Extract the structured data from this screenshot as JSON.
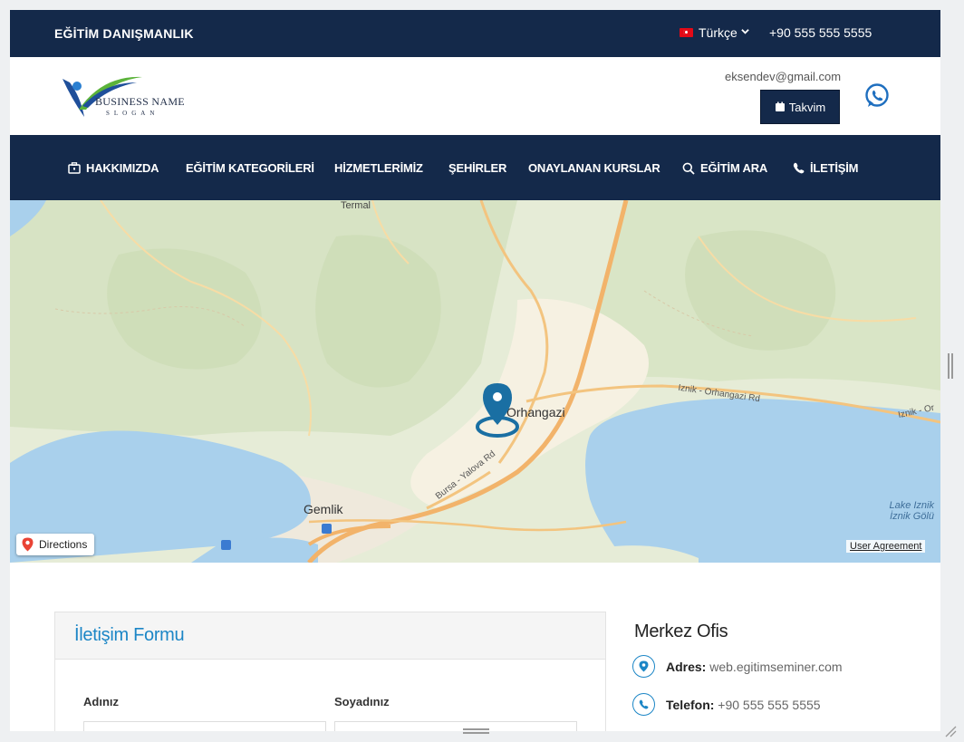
{
  "topbar": {
    "brand": "EĞİTİM DANIŞMANLIK",
    "language": "Türkçe",
    "phone": "+90 555 555 5555"
  },
  "header": {
    "logo_name": "BUSINESS NAME",
    "logo_slogan": "SLOGAN",
    "email": "eksendev@gmail.com",
    "calendar_button": "Takvim"
  },
  "nav": {
    "items": [
      {
        "label": "HAKKIMIZDA",
        "icon": "briefcase-icon"
      },
      {
        "label": "EĞİTİM KATEGORİLERİ"
      },
      {
        "label": "HİZMETLERİMİZ"
      },
      {
        "label": "ŞEHİRLER"
      },
      {
        "label": "ONAYLANAN KURSLAR"
      },
      {
        "label": "EĞİTİM ARA",
        "icon": "search-icon"
      },
      {
        "label": "İLETİŞİM",
        "icon": "phone-icon"
      }
    ]
  },
  "map": {
    "labels": {
      "termal": "Termal",
      "orhangazi": "Orhangazi",
      "gemlik": "Gemlik",
      "road_iznik_1": "Iznik - Orhangazi Rd",
      "road_iznik_2": "Iznik - Or",
      "road_bursa": "Bursa - Yalova Rd",
      "lake_1": "Lake Iznik",
      "lake_2": "İznik Gölü"
    },
    "directions_label": "Directions",
    "agreement_label": "User Agreement"
  },
  "contact_form": {
    "title": "İletişim Formu",
    "first_name_label": "Adınız",
    "last_name_label": "Soyadınız"
  },
  "office": {
    "title": "Merkez Ofis",
    "address_label": "Adres:",
    "address_value": "web.egitimseminer.com",
    "phone_label": "Telefon:",
    "phone_value": "+90 555 555 5555"
  },
  "colors": {
    "navy": "#14294a",
    "accent_blue": "#1c86c6",
    "pin": "#1a6fa3",
    "whatsapp": "#1f6fbf"
  }
}
